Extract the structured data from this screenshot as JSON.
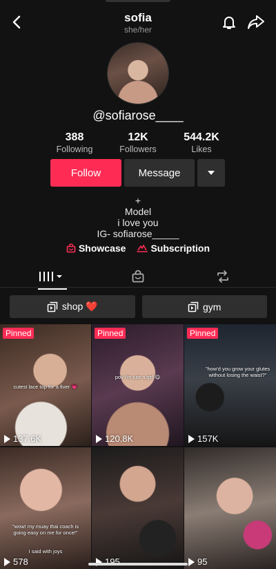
{
  "header": {
    "name": "sofia",
    "pronouns": "she/her"
  },
  "profile": {
    "handle": "@sofiarose____",
    "stats": [
      {
        "value": "388",
        "label": "Following"
      },
      {
        "value": "12K",
        "label": "Followers"
      },
      {
        "value": "544.2K",
        "label": "Likes"
      }
    ],
    "follow_label": "Follow",
    "message_label": "Message",
    "bio_lines": [
      "+",
      "Model",
      "i love you",
      "IG- sofiarose_____"
    ],
    "links": {
      "showcase": "Showcase",
      "subscription": "Subscription"
    }
  },
  "playlists": [
    {
      "label": "shop ❤️"
    },
    {
      "label": "gym"
    }
  ],
  "videos": [
    {
      "pinned": "Pinned",
      "views": "137.6K",
      "caption": "cutest lace top for a fiver 💗"
    },
    {
      "pinned": "Pinned",
      "views": "120.8K",
      "caption": "pov i'm just a girl 😋"
    },
    {
      "pinned": "Pinned",
      "views": "157K",
      "caption": "\"how'd you grow your glutes without losing the waist?\""
    },
    {
      "views": "578",
      "caption": "\"wow! my muay thai coach is going easy on me for once!\"",
      "caption2": "I said with joys"
    },
    {
      "views": "195"
    },
    {
      "views": "95"
    }
  ],
  "colors": {
    "accent": "#fe2c55",
    "background": "#121212",
    "button_dark": "#2f2f2f"
  }
}
